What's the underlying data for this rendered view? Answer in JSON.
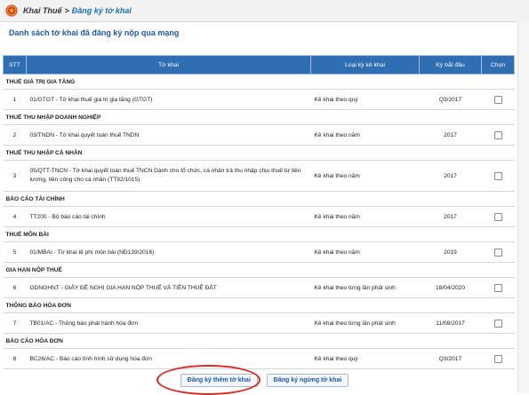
{
  "breadcrumb": {
    "root": "Khai Thuế",
    "separator": ">",
    "current": "Đăng ký tờ khai"
  },
  "page_title": "Danh sách tờ khai đã đăng ký nộp qua mạng",
  "table": {
    "headers": {
      "stt": "STT",
      "form": "Tờ khai",
      "type": "Loại kỳ kê khai",
      "period": "Kỳ bắt đầu",
      "choose": "Chọn"
    },
    "groups": [
      {
        "name": "THUẾ GIÁ TRỊ GIA TĂNG",
        "rows": [
          {
            "stt": "1",
            "form": "01/GTGT - Tờ khai thuế giá trị gia tăng (GTGT)",
            "type": "Kê khai theo quý",
            "period": "Q3/2017"
          }
        ]
      },
      {
        "name": "THUẾ THU NHẬP DOANH NGHIỆP",
        "rows": [
          {
            "stt": "2",
            "form": "03/TNDN - Tờ khai quyết toán thuế TNDN",
            "type": "Kê khai theo năm",
            "period": "2017"
          }
        ]
      },
      {
        "name": "THUẾ THU NHẬP CÁ NHÂN",
        "rows": [
          {
            "stt": "3",
            "form": "05/QTT-TNCN - Tờ khai quyết toán thuế TNCN Dành cho tổ chức, cá nhân trả thu nhập chịu thuế từ tiền lương, tiền công cho cá nhân (TT92/1015)",
            "type": "Kê khai theo năm",
            "period": "2017"
          }
        ]
      },
      {
        "name": "BÁO CÁO TÀI CHÍNH",
        "rows": [
          {
            "stt": "4",
            "form": "TT200 - Bộ báo cáo tài chính",
            "type": "Kê khai theo năm",
            "period": "2017"
          }
        ]
      },
      {
        "name": "THUẾ MÔN BÀI",
        "rows": [
          {
            "stt": "5",
            "form": "01/MBAI - Tờ khai lệ phí môn bài (NĐ139/2016)",
            "type": "Kê khai theo năm",
            "period": "2019"
          }
        ]
      },
      {
        "name": "GIA HẠN NỘP THUẾ",
        "rows": [
          {
            "stt": "6",
            "form": "GDNGHNT - GIẤY ĐỀ NGHỊ GIA HẠN NỘP THUẾ VÀ TIỀN THUÊ ĐẤT",
            "type": "Kê khai theo từng lần phát sinh",
            "period": "18/04/2020"
          }
        ]
      },
      {
        "name": "THÔNG BÁO HÓA ĐƠN",
        "rows": [
          {
            "stt": "7",
            "form": "TB01/AC - Thông báo phát hành hóa đơn",
            "type": "Kê khai theo từng lần phát sinh",
            "period": "11/08/2017"
          }
        ]
      },
      {
        "name": "BÁO CÁO HÓA ĐƠN",
        "rows": [
          {
            "stt": "8",
            "form": "BC26/AC - Báo cáo tình hình sử dụng hóa đơn",
            "type": "Kê khai theo quý",
            "period": "Q3/2017"
          }
        ]
      }
    ]
  },
  "buttons": {
    "register_more": "Đăng ký thêm tờ khai",
    "stop_register": "Đăng ký ngừng tờ khai"
  },
  "colors": {
    "header_bg": "#2f6eb3",
    "title": "#1c5aa6",
    "highlight": "#e0281c"
  },
  "icons": {
    "logo": "national-emblem-icon"
  }
}
